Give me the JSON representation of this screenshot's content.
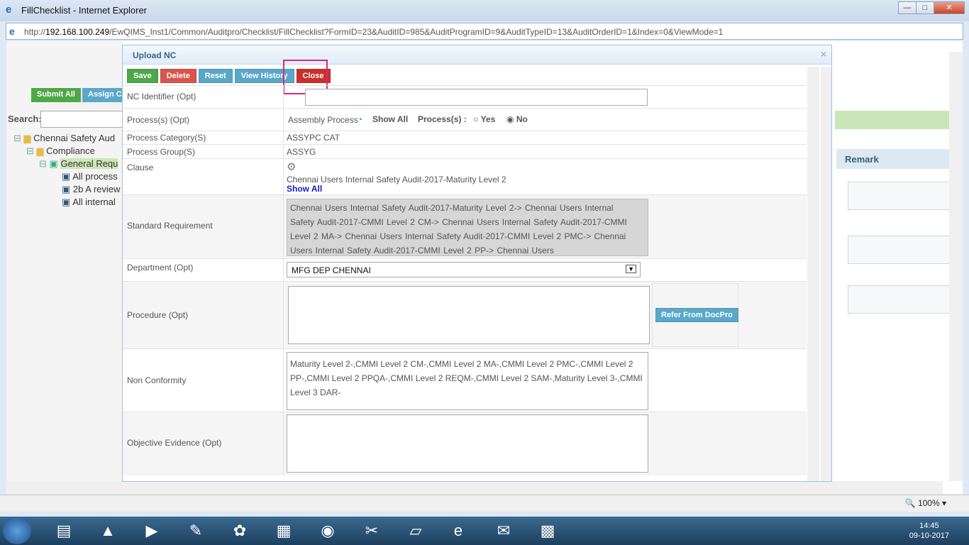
{
  "window": {
    "title": "FillChecklist - Internet Explorer",
    "minimize": "—",
    "maximize": "□",
    "close": "✕"
  },
  "address": {
    "prefix": "http://",
    "host": "192.168.100.249",
    "path": "/EwQIMS_Inst1/Common/Auditpro/Checklist/FillChecklist?FormID=23&AuditID=985&AuditProgramID=9&AuditTypeID=13&AuditOrderID=1&Index=0&ViewMode=1"
  },
  "background": {
    "submit_all": "Submit All",
    "assign": "Assign C",
    "search_label": "Search:",
    "tree": [
      {
        "label": "Chennai Safety Aud",
        "level": 0,
        "toggle": "⊟"
      },
      {
        "label": "Compliance",
        "level": 1,
        "toggle": "⊟"
      },
      {
        "label": "General Requ",
        "level": 2,
        "toggle": "⊟"
      },
      {
        "label": "All process",
        "level": 3,
        "toggle": ""
      },
      {
        "label": "2b A review",
        "level": 3,
        "toggle": ""
      },
      {
        "label": "All internal",
        "level": 3,
        "toggle": ""
      }
    ],
    "remark_header": "Remark"
  },
  "dialog": {
    "title": "Upload NC",
    "close_x": "×",
    "buttons": {
      "save": "Save",
      "delete": "Delete",
      "reset": "Reset",
      "view_history": "View History",
      "close": "Close"
    },
    "fields": {
      "nc_identifier": {
        "label": "NC Identifier (Opt)",
        "value": ""
      },
      "processes": {
        "label": "Process(s) (Opt)",
        "value": "Assembly Process",
        "show_all": "Show All",
        "radio_label": "Process(s) :",
        "yes": "Yes",
        "no": "No",
        "selected": "No"
      },
      "process_category": {
        "label": "Process Category(S)",
        "value": "ASSYPC CAT"
      },
      "process_group": {
        "label": "Process Group(S)",
        "value": "ASSYG"
      },
      "clause": {
        "label": "Clause",
        "value": "Chennai Users Internal Safety Audit-2017-Maturity Level 2",
        "show_all": "Show All"
      },
      "standard_requirement": {
        "label": "Standard Requirement",
        "value": "Chennai Users Internal Safety Audit-2017-Maturity Level 2->          Chennai Users Internal Safety Audit-2017-CMMI Level 2 CM->          Chennai Users Internal Safety Audit-2017-CMMI Level 2 MA->          Chennai Users Internal Safety Audit-2017-CMMI Level 2 PMC->          Chennai Users Internal Safety Audit-2017-CMMI Level 2 PP->          Chennai Users"
      },
      "department": {
        "label": "Department (Opt)",
        "value": "MFG DEP CHENNAI"
      },
      "procedure": {
        "label": "Procedure (Opt)",
        "value": "",
        "refer_button": "Refer From DocPro"
      },
      "non_conformity": {
        "label": "Non Conformity",
        "value": "Maturity Level 2-,CMMI Level 2 CM-,CMMI Level 2 MA-,CMMI Level 2 PMC-,CMMI Level 2 PP-,CMMI Level 2 PPQA-,CMMI Level 2 REQM-,CMMI Level 2 SAM-,Maturity Level 3-,CMMI Level 3 DAR-"
      },
      "objective_evidence": {
        "label": "Objective Evidence (Opt)",
        "value": ""
      }
    }
  },
  "statusbar": {
    "zoom": "100%"
  },
  "taskbar": {
    "time": "14:45",
    "date": "09-10-2017"
  }
}
